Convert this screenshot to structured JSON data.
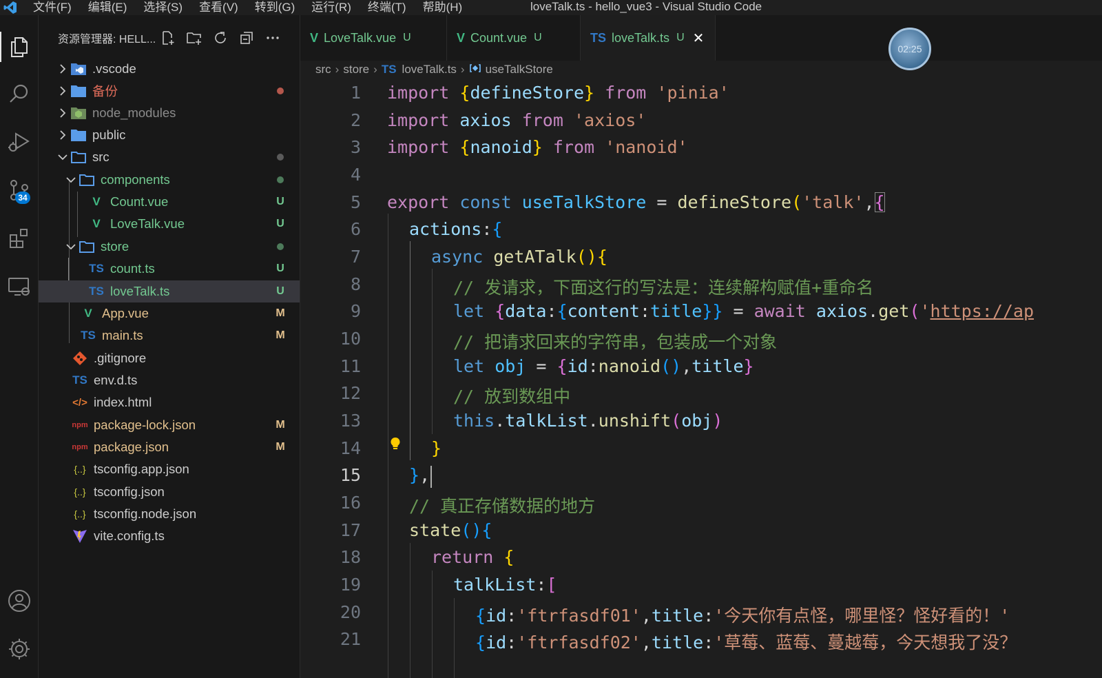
{
  "window_title": "loveTalk.ts - hello_vue3 - Visual Studio Code",
  "menu": [
    "文件(F)",
    "编辑(E)",
    "选择(S)",
    "查看(V)",
    "转到(G)",
    "运行(R)",
    "终端(T)",
    "帮助(H)"
  ],
  "activity": {
    "scm_badge": "34"
  },
  "explorer": {
    "title": "资源管理器: HELL...",
    "items": [
      {
        "label": ".vscode",
        "status": ""
      },
      {
        "label": "备份",
        "status": ""
      },
      {
        "label": "node_modules",
        "status": ""
      },
      {
        "label": "public",
        "status": ""
      },
      {
        "label": "src",
        "status": ""
      },
      {
        "label": "components",
        "status": ""
      },
      {
        "label": "Count.vue",
        "status": "U"
      },
      {
        "label": "LoveTalk.vue",
        "status": "U"
      },
      {
        "label": "store",
        "status": ""
      },
      {
        "label": "count.ts",
        "status": "U"
      },
      {
        "label": "loveTalk.ts",
        "status": "U"
      },
      {
        "label": "App.vue",
        "status": "M"
      },
      {
        "label": "main.ts",
        "status": "M"
      },
      {
        "label": ".gitignore",
        "status": ""
      },
      {
        "label": "env.d.ts",
        "status": ""
      },
      {
        "label": "index.html",
        "status": ""
      },
      {
        "label": "package-lock.json",
        "status": "M"
      },
      {
        "label": "package.json",
        "status": "M"
      },
      {
        "label": "tsconfig.app.json",
        "status": ""
      },
      {
        "label": "tsconfig.json",
        "status": ""
      },
      {
        "label": "tsconfig.node.json",
        "status": ""
      },
      {
        "label": "vite.config.ts",
        "status": ""
      }
    ],
    "icons": {
      "vue": "V",
      "ts": "TS",
      "npm": "npm",
      "json": "{..}",
      "html": "</>"
    }
  },
  "tabs": [
    {
      "label": "LoveTalk.vue",
      "status": "U",
      "icon": "V"
    },
    {
      "label": "Count.vue",
      "status": "U",
      "icon": "V"
    },
    {
      "label": "loveTalk.ts",
      "status": "U",
      "icon": "TS",
      "close": "✕"
    }
  ],
  "timer": "02:25",
  "breadcrumb": {
    "parts": [
      "src",
      "store",
      "loveTalk.ts",
      "useTalkStore"
    ],
    "ts_icon": "TS",
    "sep": "›"
  },
  "editor": {
    "active_line": 15,
    "line_numbers": [
      "1",
      "2",
      "3",
      "4",
      "5",
      "6",
      "7",
      "8",
      "9",
      "10",
      "11",
      "12",
      "13",
      "14",
      "15",
      "16",
      "17",
      "18",
      "19",
      "20",
      "21"
    ],
    "lines": {
      "l1": [
        "import",
        " ",
        "{",
        "defineStore",
        "}",
        " ",
        "from",
        " ",
        "'pinia'"
      ],
      "l2": [
        "import",
        " ",
        "axios",
        " ",
        "from",
        " ",
        "'axios'"
      ],
      "l3": [
        "import",
        " ",
        "{",
        "nanoid",
        "}",
        " ",
        "from",
        " ",
        "'nanoid'"
      ],
      "l5": [
        "export",
        " ",
        "const",
        " ",
        "useTalkStore",
        " = ",
        "defineStore",
        "(",
        "'talk'",
        ",",
        "{"
      ],
      "l6": [
        "actions",
        ":",
        "{"
      ],
      "l7": [
        "async",
        " ",
        "getATalk",
        "()",
        "{"
      ],
      "l8": "// 发请求，下面这行的写法是：连续解构赋值+重命名",
      "l9": [
        "let",
        " ",
        "{",
        "data",
        ":",
        "{",
        "content",
        ":",
        "title",
        "}}",
        " = ",
        "await",
        " ",
        "axios",
        ".",
        "get",
        "(",
        "'",
        "https://ap"
      ],
      "l10": "// 把请求回来的字符串，包装成一个对象",
      "l11": [
        "let",
        " ",
        "obj",
        " = ",
        "{",
        "id",
        ":",
        "nanoid",
        "()",
        ",",
        "title",
        "}"
      ],
      "l12": "// 放到数组中",
      "l13": [
        "this",
        ".",
        "talkList",
        ".",
        "unshift",
        "(",
        "obj",
        ")"
      ],
      "l14": "}",
      "l15": [
        "}",
        ","
      ],
      "l16": "// 真正存储数据的地方",
      "l17": [
        "state",
        "()",
        "{"
      ],
      "l18": [
        "return",
        " ",
        "{"
      ],
      "l19": [
        "talkList",
        ":",
        "["
      ],
      "l20": [
        "{",
        "id",
        ":",
        "'ftrfasdf01'",
        ",",
        "title",
        ":",
        "'今天你有点怪，哪里怪？怪好看的！'"
      ],
      "l21": [
        "{",
        "id",
        ":",
        "'ftrfasdf02'",
        ",",
        "title",
        ":",
        "'草莓、蓝莓、蔓越莓，今天想我了没？"
      ]
    }
  }
}
